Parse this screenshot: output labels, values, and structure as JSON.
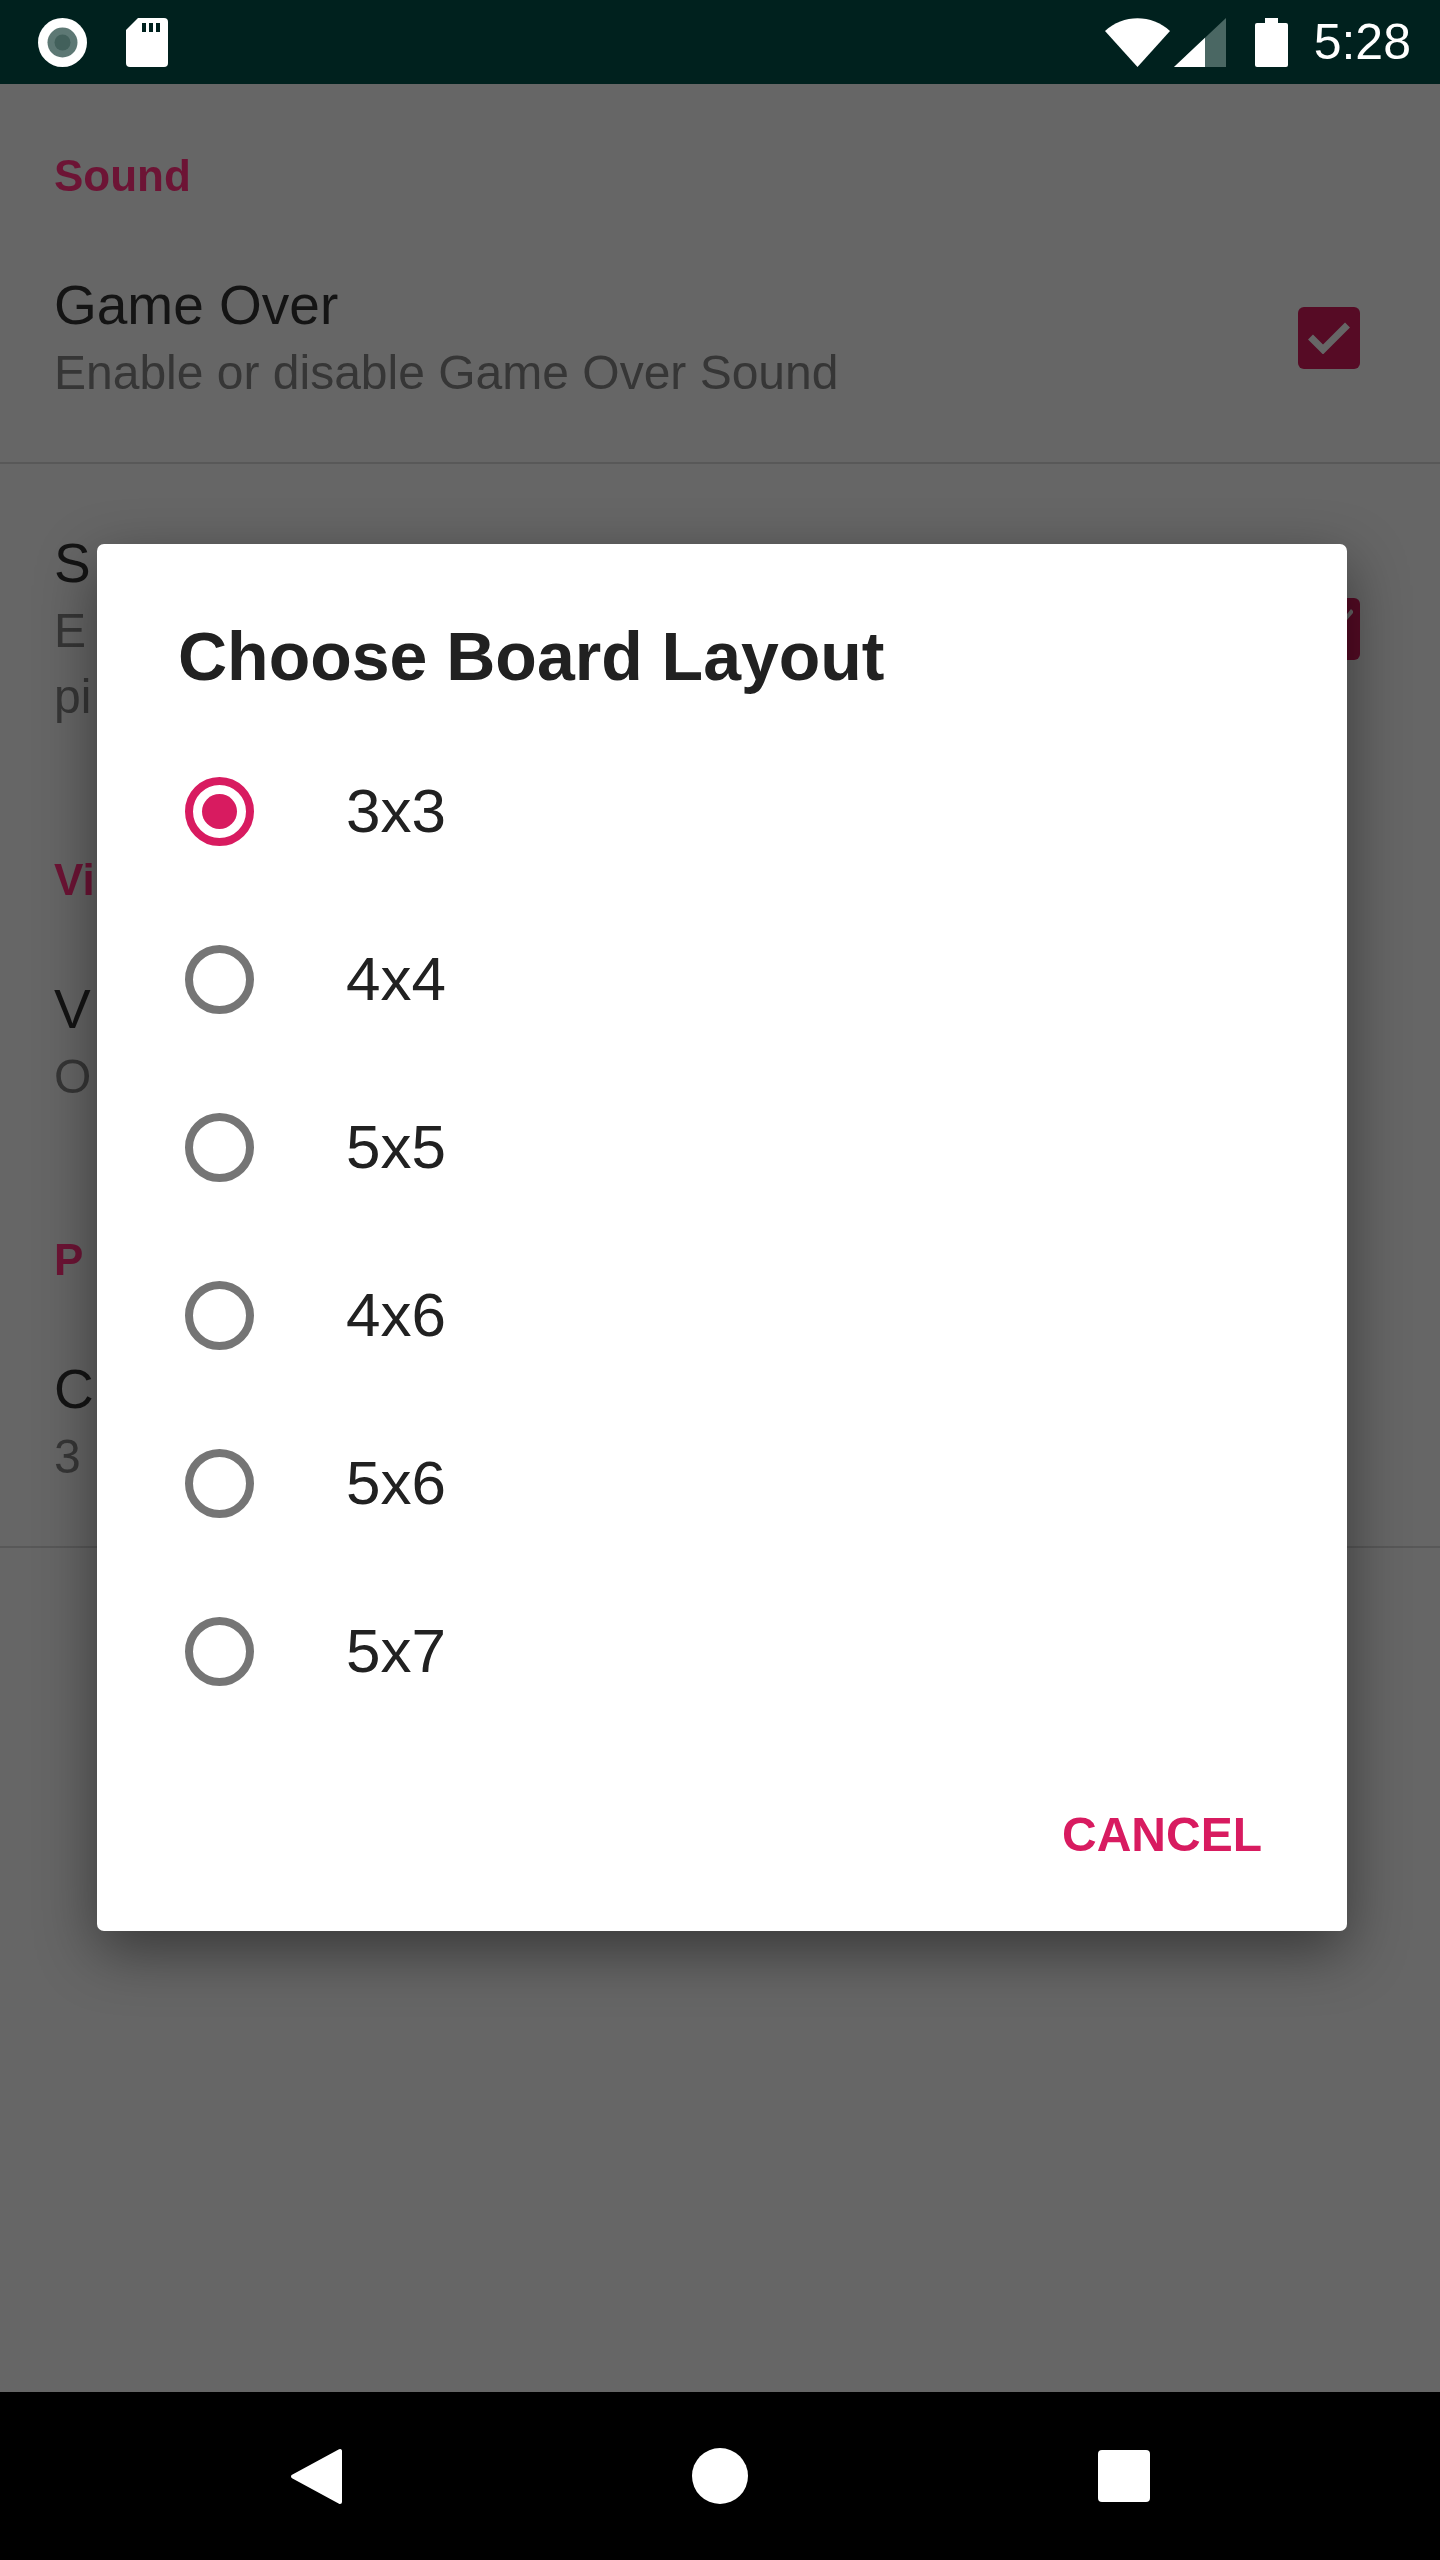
{
  "status_bar": {
    "time": "5:28"
  },
  "settings": {
    "categories": [
      {
        "title": "Sound",
        "items": [
          {
            "title": "Game Over",
            "summary_lines": [
              "Enable or disable Game Over Sound"
            ],
            "checked": true,
            "checkbox_partly_hidden": false,
            "divider_below": true
          },
          {
            "title": "S",
            "summary_lines": [
              "E",
              "pi"
            ],
            "checked": true,
            "checkbox_partly_hidden": true,
            "divider_below": false
          }
        ]
      },
      {
        "title": "Vi",
        "items": [
          {
            "title": "V",
            "summary_lines": [
              "O"
            ],
            "divider_below": false
          }
        ]
      },
      {
        "title": "P",
        "items": [
          {
            "title": "C",
            "summary_lines": [
              "3"
            ],
            "divider_below": true
          }
        ]
      }
    ]
  },
  "dialog": {
    "title": "Choose Board Layout",
    "options": [
      {
        "label": "3x3",
        "selected": true
      },
      {
        "label": "4x4",
        "selected": false
      },
      {
        "label": "5x5",
        "selected": false
      },
      {
        "label": "4x6",
        "selected": false
      },
      {
        "label": "5x6",
        "selected": false
      },
      {
        "label": "5x7",
        "selected": false
      }
    ],
    "buttons": [
      "CANCEL"
    ]
  }
}
